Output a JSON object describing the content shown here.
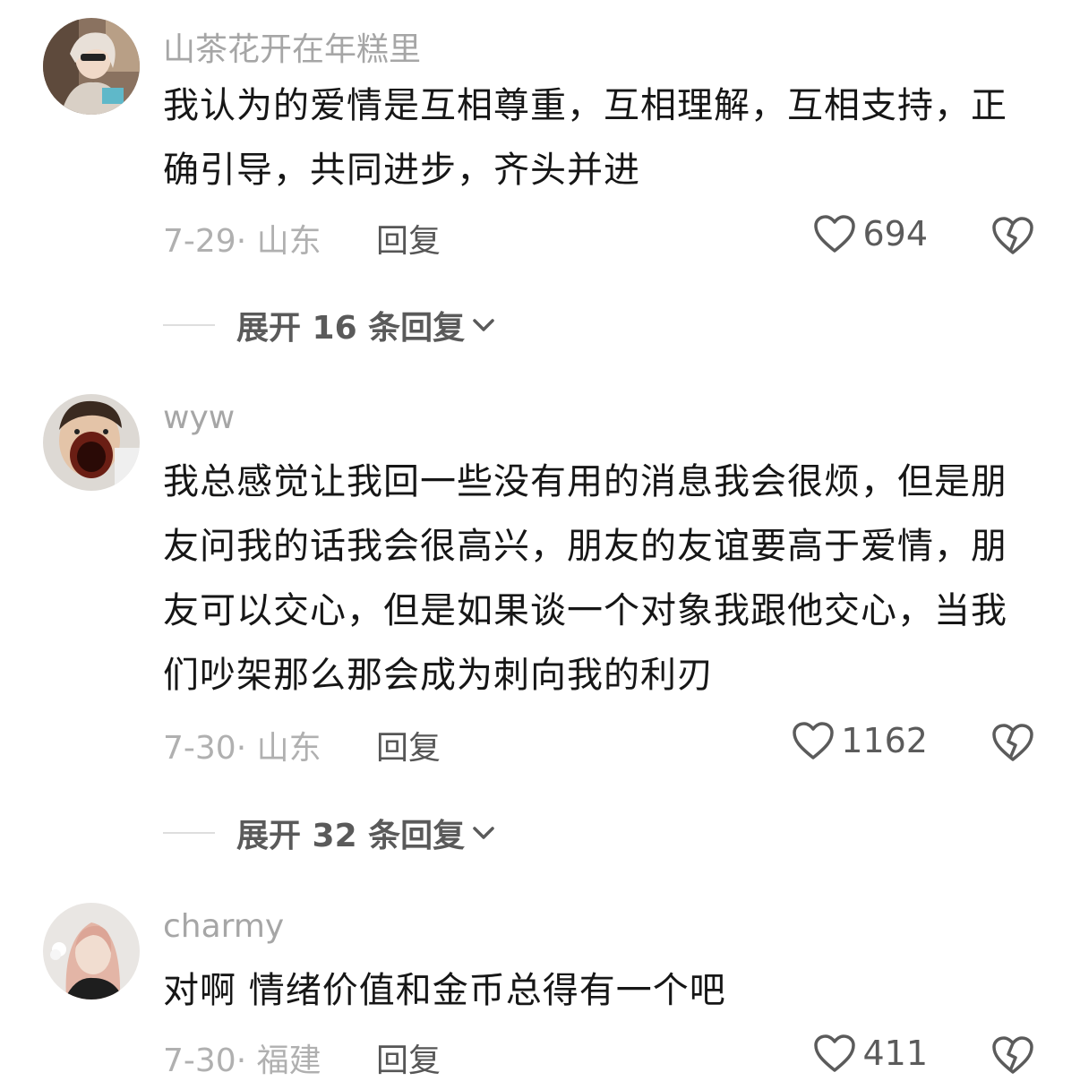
{
  "comments": [
    {
      "username": "山茶花开在年糕里",
      "text": "我认为的爱情是互相尊重，互相理解，互相支持，正确引导，共同进步，齐头并进",
      "meta": "7-29· 山东",
      "reply_label": "回复",
      "likes": "694",
      "expand_label": "展开 16 条回复"
    },
    {
      "username": "wyw",
      "text": "我总感觉让我回一些没有用的消息我会很烦，但是朋友问我的话我会很高兴，朋友的友谊要高于爱情，朋友可以交心，但是如果谈一个对象我跟他交心，当我们吵架那么那会成为刺向我的利刃",
      "meta": "7-30· 山东",
      "reply_label": "回复",
      "likes": "1162",
      "expand_label": "展开 32 条回复"
    },
    {
      "username": "charmy",
      "text": "对啊  情绪价值和金币总得有一个吧",
      "meta": "7-30· 福建",
      "reply_label": "回复",
      "likes": "411"
    }
  ],
  "icons": {
    "like": "heart-outline-icon",
    "dislike": "broken-heart-icon",
    "expand": "chevron-down-icon"
  },
  "colors": {
    "username": "#a6a6a6",
    "text": "#161616",
    "meta": "#b0b0b0",
    "action": "#5b5b5b"
  }
}
